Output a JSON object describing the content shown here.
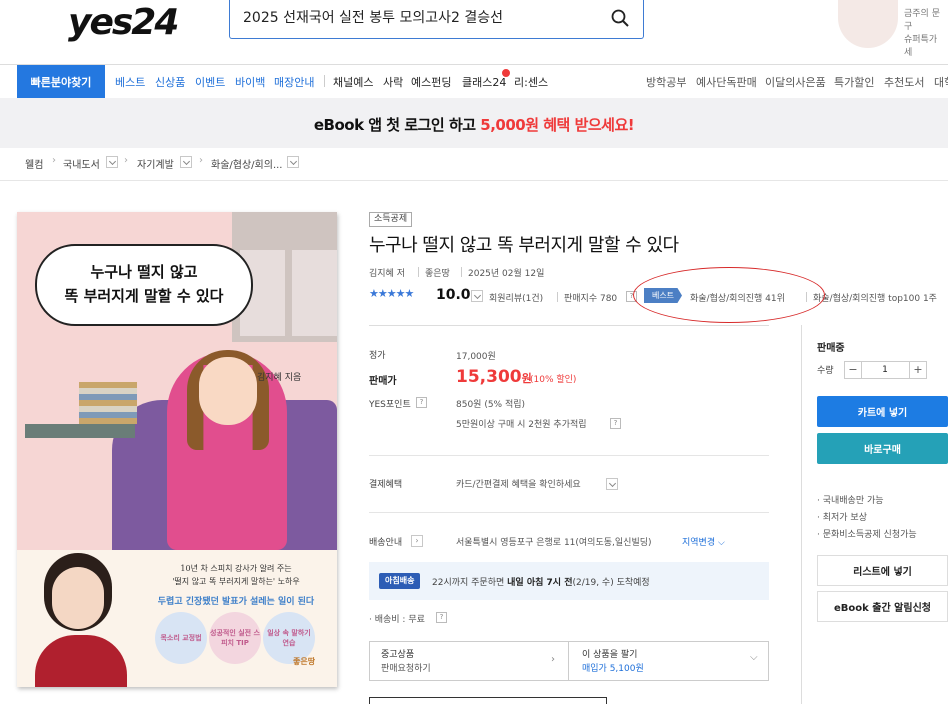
{
  "header": {
    "logo": "yes24",
    "search_value": "2025 선재국어 실전 봉투 모의고사2 결승선",
    "promo_line1": "금주의 문구",
    "promo_line2": "슈퍼특가 세"
  },
  "nav": {
    "quick_label": "빠른분야찾기",
    "items_blue": [
      "베스트",
      "신상품",
      "이벤트",
      "바이백",
      "매장안내"
    ],
    "items_dark": [
      "채널예스",
      "사락",
      "예스펀딩",
      "클래스24",
      "리:센스"
    ],
    "items_right": [
      "방학공부",
      "예사단독판매",
      "이달의사은품",
      "특가할인",
      "추천도서",
      "대학"
    ]
  },
  "banner": {
    "prefix": "eBook 앱 첫 로그인 하고 ",
    "highlight": "5,000원 혜택 받으세요!"
  },
  "breadcrumb": {
    "home": "웰컴",
    "cat1": "국내도서",
    "cat2": "자기계발",
    "cat3": "화술/협상/회의..."
  },
  "cover": {
    "title_line1": "누구나 떨지 않고",
    "title_line2": "똑 부러지게 말할 수 있다",
    "author": "김지혜 지음",
    "sub_line1": "10년 차 스피치 강사가 알려 주는",
    "sub_line2": "'떨지 않고 똑 부러지게 말하는' 노하우",
    "sub_highlight": "두렵고 긴장됐던 발표가 설레는 일이 된다",
    "circle1": "목소리 교정법",
    "circle2": "성공적인 실전 스피치 TIP",
    "circle3": "일상 속 말하기 연습",
    "publisher": "좋은땅"
  },
  "product": {
    "badge": "소득공제",
    "title": "누구나 떨지 않고 똑 부러지게 말할 수 있다",
    "author": "김지혜 저",
    "publisher": "좋은땅",
    "date": "2025년 02월 12일",
    "stars": "★★★★★",
    "score": "10.0",
    "reviews": "회원리뷰(1건)",
    "sales_index": "판매지수 780",
    "best_badge": "베스트",
    "rank1": "화술/협상/회의진행 41위",
    "rank2": "화술/협상/회의진행 top100 1주"
  },
  "price": {
    "list_label": "정가",
    "list_value": "17,000원",
    "sale_label": "판매가",
    "sale_value": "15,300",
    "sale_unit": "원",
    "discount": "(10% 할인)",
    "point_label": "YES포인트",
    "point_value": "850원 (5% 적립)",
    "point_extra": "5만원이상 구매 시 2천원 추가적립"
  },
  "payment": {
    "label": "결제혜택",
    "value": "카드/간편결제 혜택을 확인하세요"
  },
  "delivery": {
    "label": "배송안내",
    "address": "서울특별시 영등포구 은행로 11(여의도동,일신빌딩)",
    "change": "지역변경",
    "morning_badge": "아침배송",
    "morning_text_pre": "22시까지 주문하면 ",
    "morning_text_bold": "내일 아침 7시 전",
    "morning_text_post": "(2/19, 수) 도착예정",
    "fee": "· 배송비 : 무료"
  },
  "used": {
    "box1_line1": "중고상품",
    "box1_line2": "판매요청하기",
    "box2_line1": "이 상품을 팔기",
    "box2_line2": "매입가 5,100원"
  },
  "side": {
    "status": "판매중",
    "qty_label": "수량",
    "qty_value": "1",
    "minus": "−",
    "plus": "+",
    "cart": "카트에 넣기",
    "buy": "바로구매",
    "bullets": [
      "· 국내배송만 가능",
      "· 최저가 보상",
      "· 문화비소득공제 신청가능"
    ],
    "list_btn": "리스트에 넣기",
    "ebook_btn": "eBook 출간 알림신청"
  },
  "colors": {
    "accent_blue": "#1d7ce3",
    "sale_red": "#ef3a3a",
    "teal": "#25a1b7",
    "annotation_red": "#d72a2a"
  }
}
